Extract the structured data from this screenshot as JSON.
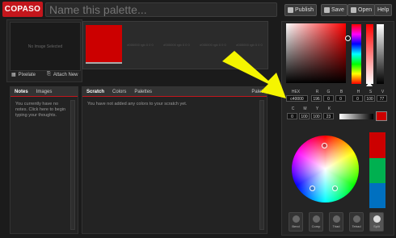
{
  "app": {
    "logo": "COPASO",
    "name_placeholder": "Name this palette..."
  },
  "toolbar": {
    "publish": "Publish",
    "save": "Save",
    "open": "Open",
    "help": "Help"
  },
  "image_panel": {
    "empty_text": "No Image Selected",
    "pixelate": "Pixelate",
    "attach": "Attach New"
  },
  "swatches": [
    {
      "color": "#cc0000",
      "label": ""
    },
    {
      "color": "",
      "label": "#000000 rgb 0 0 0"
    },
    {
      "color": "",
      "label": "#000000 rgb 0 0 0"
    },
    {
      "color": "",
      "label": "#000000 rgb 0 0 0"
    },
    {
      "color": "",
      "label": "#000000 rgb 0 0 0"
    }
  ],
  "notes": {
    "tabs": [
      "Notes",
      "Images"
    ],
    "text": "You currently have no notes. Click here to begin typing your thoughts."
  },
  "scratch": {
    "tabs": [
      "Scratch",
      "Colors",
      "Palettes"
    ],
    "right_tab": "Palet",
    "text": "You have not added any colors to your scratch yet."
  },
  "picker": {
    "labels": {
      "hex": "HEX",
      "r": "R",
      "g": "G",
      "b": "B",
      "h": "H",
      "s": "S",
      "v": "V",
      "c": "C",
      "m": "M",
      "y": "Y",
      "k": "K"
    },
    "values": {
      "hex": "c40000",
      "r": "196",
      "g": "0",
      "b": "0",
      "h": "0",
      "s": "100",
      "v": "77",
      "c": "0",
      "m": "100",
      "y": "100",
      "k": "23"
    }
  },
  "harmony_modes": [
    "Bend",
    "Comp",
    "Triad",
    "Tetrad",
    "Split"
  ],
  "colors": {
    "accent": "#c4161c",
    "selected": "#cc0000",
    "green": "#00b050",
    "blue": "#0070c0"
  }
}
